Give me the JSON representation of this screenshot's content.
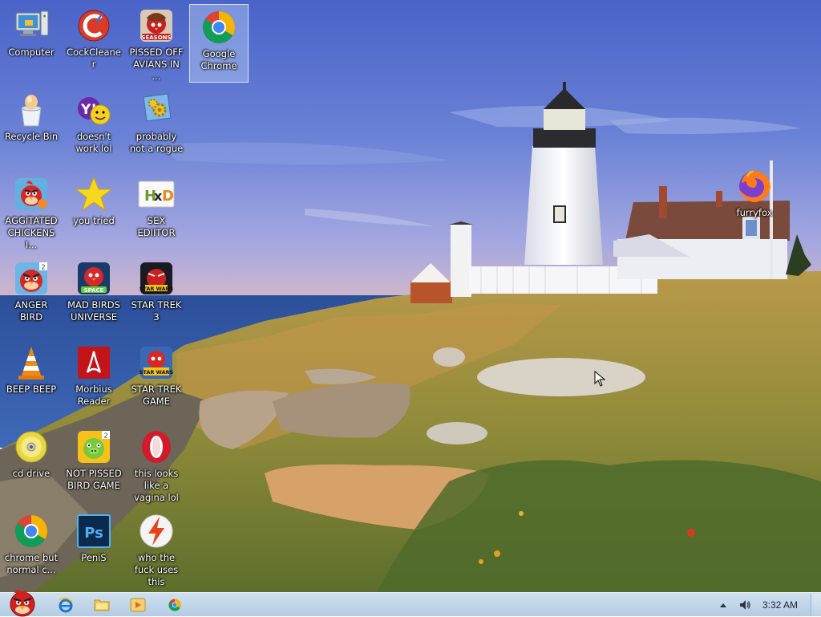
{
  "desktop": {
    "icons": [
      {
        "label": "Computer",
        "glyph": "computer-icon"
      },
      {
        "label": "CockCleaner",
        "glyph": "ccleaner-icon"
      },
      {
        "label": "PISSED OFF AVIANS IN ...",
        "glyph": "seasons-bird-icon"
      },
      {
        "label": "Google Chrome",
        "glyph": "chrome-icon",
        "selected": true
      },
      {
        "label": "Recycle Bin",
        "glyph": "recycle-bin-icon"
      },
      {
        "label": "doesn't work lol",
        "glyph": "yahoo-messenger-icon"
      },
      {
        "label": "probably not a rogue",
        "glyph": "gear-program-icon"
      },
      {
        "label": "AGGITATED CHICKENS I...",
        "glyph": "angry-bird-icon"
      },
      {
        "label": "you tried",
        "glyph": "star-icon"
      },
      {
        "label": "SEX EDIITOR",
        "glyph": "hxd-icon"
      },
      {
        "label": "ANGER BIRD",
        "glyph": "angry-bird-icon"
      },
      {
        "label": "MAD BIRDS UNIVERSE",
        "glyph": "angry-bird-space-icon"
      },
      {
        "label": "STAR TREK 3",
        "glyph": "star-wars-bird-icon"
      },
      {
        "label": "BEEP BEEP",
        "glyph": "vlc-cone-icon"
      },
      {
        "label": "Morbius Reader",
        "glyph": "pdf-reader-icon"
      },
      {
        "label": "STAR TREK GAME",
        "glyph": "star-wars-bird-icon"
      },
      {
        "label": "cd drive",
        "glyph": "cd-drive-icon"
      },
      {
        "label": "NOT PISSED BIRD GAME",
        "glyph": "green-pig-icon"
      },
      {
        "label": "this looks like a vagina lol",
        "glyph": "opera-icon"
      },
      {
        "label": "chrome but normal c...",
        "glyph": "chrome-icon"
      },
      {
        "label": "PeniS",
        "glyph": "photoshop-icon"
      },
      {
        "label": "who the fuck uses this",
        "glyph": "flash-icon"
      },
      {
        "label": "furryfox",
        "glyph": "firefox-icon"
      }
    ]
  },
  "taskbar": {
    "start": {
      "glyph": "angry-bird-start-icon"
    },
    "pinned": [
      {
        "glyph": "internet-explorer-icon"
      },
      {
        "glyph": "folder-icon"
      },
      {
        "glyph": "media-player-icon"
      },
      {
        "glyph": "chrome-icon"
      }
    ],
    "tray": {
      "chevron_glyph": "chevron-up-icon",
      "volume_glyph": "speaker-icon",
      "clock": "3:32 AM"
    }
  },
  "colors": {
    "taskbar": "#bcd2e8",
    "selection": "#bed7f5",
    "label_text": "#ffffff"
  }
}
